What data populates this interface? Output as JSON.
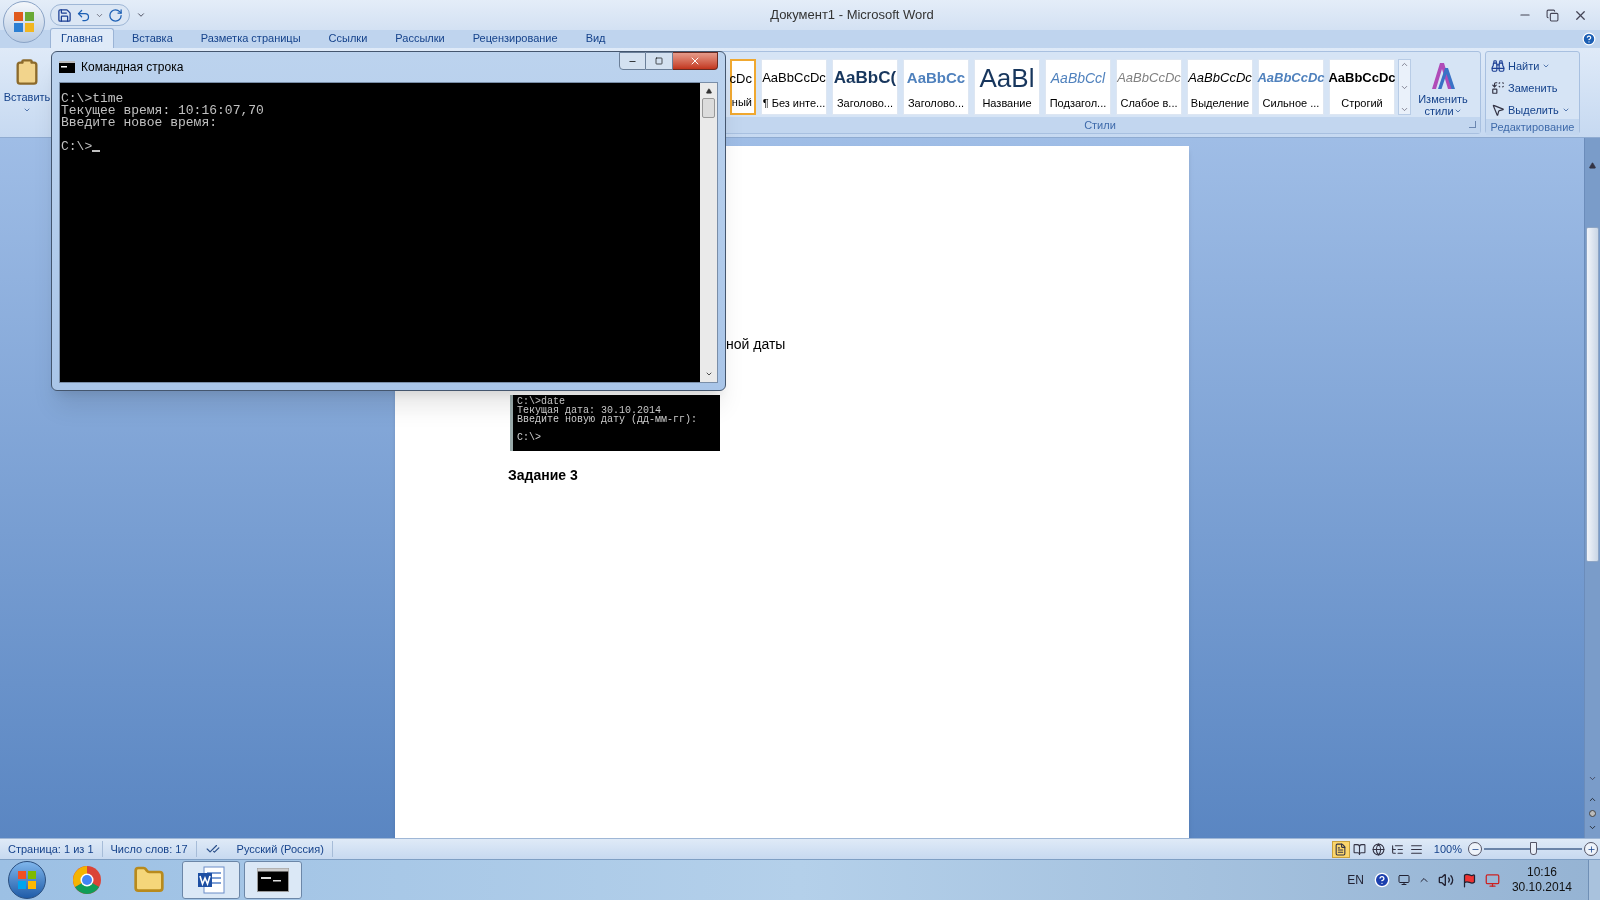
{
  "word_window": {
    "title": "Документ1 - Microsoft Word"
  },
  "ribbon_tabs": [
    {
      "label": "Главная",
      "selected": true
    },
    {
      "label": "Вставка",
      "selected": false
    },
    {
      "label": "Разметка страницы",
      "selected": false
    },
    {
      "label": "Ссылки",
      "selected": false
    },
    {
      "label": "Рассылки",
      "selected": false
    },
    {
      "label": "Рецензирование",
      "selected": false
    },
    {
      "label": "Вид",
      "selected": false
    }
  ],
  "clipboard": {
    "paste_label": "Вставить"
  },
  "styles_group": {
    "label": "Стили",
    "items": [
      {
        "sample": "cDc",
        "label": "ный",
        "kind": "normal",
        "selected": true
      },
      {
        "sample": "AaBbCcDc",
        "label": "¶ Без инте...",
        "kind": "normal",
        "selected": false
      },
      {
        "sample": "AaBbC(",
        "label": "Заголово...",
        "kind": "heading1",
        "selected": false
      },
      {
        "sample": "AaBbCc",
        "label": "Заголово...",
        "kind": "heading2",
        "selected": false
      },
      {
        "sample": "AaBl",
        "label": "Название",
        "kind": "title",
        "selected": false
      },
      {
        "sample": "AaBbCcl",
        "label": "Подзагол...",
        "kind": "subtitle",
        "selected": false
      },
      {
        "sample": "AaBbCcDc",
        "label": "Слабое в...",
        "kind": "subtle",
        "selected": false
      },
      {
        "sample": "AaBbCcDc",
        "label": "Выделение",
        "kind": "emphasis",
        "selected": false
      },
      {
        "sample": "AaBbCcDc",
        "label": "Сильное ...",
        "kind": "intense",
        "selected": false
      },
      {
        "sample": "AaBbCcDc",
        "label": "Строгий",
        "kind": "strong",
        "selected": false
      }
    ],
    "change_styles": [
      "Изменить",
      "стили"
    ]
  },
  "editing_group": {
    "label": "Редактирование",
    "items": [
      {
        "label": "Найти",
        "kind": "find"
      },
      {
        "label": "Заменить",
        "kind": "replace"
      },
      {
        "label": "Выделить",
        "kind": "select"
      }
    ]
  },
  "document": {
    "blocks": [
      {
        "kind": "text",
        "text": "ной даты"
      },
      {
        "kind": "screenshot",
        "groups": [
          [
            "C:\\>date",
            "Текущая дата: 30.10.2014",
            "Введите новую дату (дд-мм-гг):"
          ],
          [
            "C:\\>"
          ]
        ]
      },
      {
        "kind": "heading",
        "text": "Задание 3"
      }
    ]
  },
  "command_prompt": {
    "title": "Командная строка",
    "groups": [
      [
        "C:\\>time",
        "Текущее время: 10:16:07,70",
        "Введите новое время:"
      ],
      [
        "C:\\>"
      ]
    ],
    "cursor": true
  },
  "status_bar": {
    "page": "Страница: 1 из 1",
    "words": "Число слов: 17",
    "language": "Русский (Россия)",
    "views": [
      {
        "kind": "print",
        "selected": true
      },
      {
        "kind": "reading",
        "selected": false
      },
      {
        "kind": "web",
        "selected": false
      },
      {
        "kind": "outline",
        "selected": false
      },
      {
        "kind": "draft",
        "selected": false
      }
    ],
    "zoom": "100%",
    "zoom_slider": {
      "level": 0.5
    }
  },
  "taskbar": {
    "apps": [
      {
        "kind": "browser",
        "active": false
      },
      {
        "kind": "folder",
        "active": false
      },
      {
        "kind": "word",
        "active": true
      },
      {
        "kind": "console",
        "active": true
      }
    ],
    "language": "EN",
    "time": "10:16",
    "date": "30.10.2014"
  }
}
